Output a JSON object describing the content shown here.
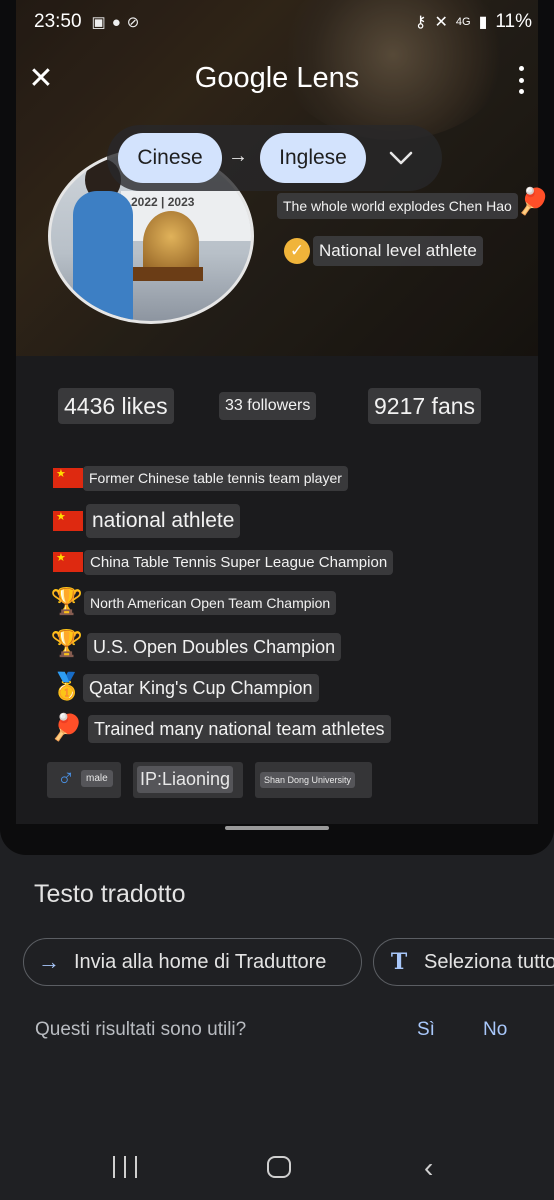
{
  "status_bar": {
    "time": "23:50",
    "battery": "11%",
    "network": "4G",
    "icons": [
      "gallery-icon",
      "wechat-icon",
      "link-icon",
      "key-icon",
      "mute-icon",
      "signal-icon",
      "battery-icon"
    ]
  },
  "lens": {
    "close_icon": "close-icon",
    "title": "Google Lens",
    "menu_icon": "more-vert-icon"
  },
  "translation": {
    "source_language": "Cinese",
    "target_language": "Inglese",
    "arrow": "→"
  },
  "profile": {
    "bio": "The whole world explodes Chen Hao",
    "certification": "National level athlete",
    "stats": {
      "likes": "4436 likes",
      "followers": "33 followers",
      "fans": "9217 fans"
    },
    "achievements": [
      {
        "icon": "china-flag-icon",
        "text": "Former Chinese table tennis team player"
      },
      {
        "icon": "china-flag-icon",
        "text": "national athlete"
      },
      {
        "icon": "china-flag-icon",
        "text": "China Table Tennis Super League Champion"
      },
      {
        "icon": "trophy-icon",
        "text": "North American Open Team Champion"
      },
      {
        "icon": "trophy-icon",
        "text": "U.S. Open Doubles Champion"
      },
      {
        "icon": "medal-icon",
        "text": "Qatar King's Cup Champion"
      },
      {
        "icon": "ping-pong-icon",
        "text": "Trained many national team athletes"
      }
    ],
    "tags": {
      "gender_symbol": "♂",
      "gender": "male",
      "ip": "IP:Liaoning",
      "school": "Shan Dong University"
    },
    "avatar_banner": "2022 | 2023"
  },
  "sheet": {
    "title": "Testo tradotto",
    "send_label": "Invia alla home di Traduttore",
    "select_label": "Seleziona tutto",
    "question": "Questi risultati sono utili?",
    "yes": "Sì",
    "no": "No"
  },
  "colors": {
    "accent": "#a8c7fa",
    "pill": "#d3e3fd",
    "verified": "#f0b43a",
    "background": "#1f2023"
  },
  "nav_bar": {
    "icons": [
      "recent-apps-icon",
      "home-icon",
      "back-icon"
    ]
  }
}
